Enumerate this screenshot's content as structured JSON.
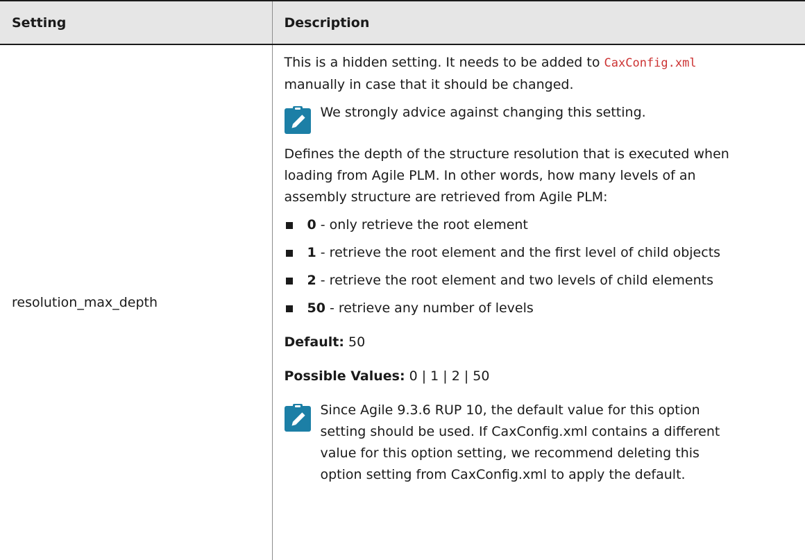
{
  "table": {
    "headers": [
      "Setting",
      "Description"
    ],
    "row": {
      "setting": "resolution_max_depth",
      "intro_text": "This is a hidden setting. It needs to be added to ",
      "intro_code": "CaxConfig.xml",
      "intro_text_after": "manually in case that it should be changed.",
      "note1": "We strongly advice against changing this setting.",
      "definition_lines": [
        "Defines the depth of the structure resolution that is executed when",
        "loading from Agile PLM. In other words, how many levels of an",
        "assembly structure are retrieved from Agile PLM:"
      ],
      "levels": [
        {
          "value": "0",
          "text": " - only retrieve the root element"
        },
        {
          "value": "1",
          "text": " - retrieve the root element and the first level of child objects"
        },
        {
          "value": "2",
          "text": " - retrieve the root element and two levels of child elements"
        },
        {
          "value": "50",
          "text": " - retrieve any number of levels"
        }
      ],
      "default_label": "Default:",
      "default_value": " 50",
      "possible_label": "Possible Values:",
      "possible_value": " 0 | 1 | 2 | 50",
      "note2_lines": [
        "Since Agile 9.3.6 RUP 10, the default value for this option",
        "setting should be used. If CaxConfig.xml contains a different",
        "value for this option setting, we recommend deleting this",
        "option setting from CaxConfig.xml to apply the default."
      ]
    }
  },
  "icons": {
    "note": "pencil-note-icon",
    "bullet": "square-bullet-icon"
  },
  "colors": {
    "note_icon": "#1c7fa6",
    "code_text": "#cc3333",
    "header_bg": "#e6e6e6"
  }
}
